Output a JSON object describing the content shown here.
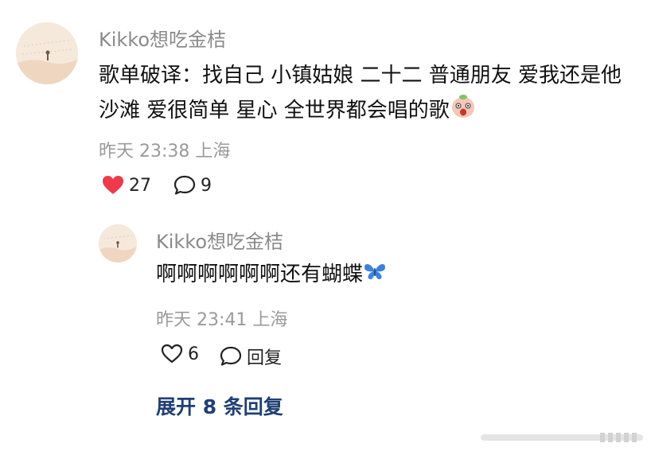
{
  "comment": {
    "username": "Kikko想吃金桔",
    "text": "歌单破译：找自己 小镇姑娘 二十二 普通朋友 爱我还是他 沙滩 爱很简单 星心 全世界都会唱的歌",
    "emoji": "face-emoji",
    "time": "昨天 23:38",
    "location": "上海",
    "likes": "27",
    "replies_count": "9",
    "liked": true
  },
  "reply": {
    "username": "Kikko想吃金桔",
    "text": "啊啊啊啊啊啊还有蝴蝶",
    "emoji": "butterfly-emoji",
    "time": "昨天 23:41",
    "location": "上海",
    "likes": "6",
    "reply_label": "回复"
  },
  "expand_label": "展开 8 条回复",
  "colors": {
    "like_red": "#f0394b",
    "link_blue": "#1f3f77",
    "meta_gray": "#9a9a9a"
  }
}
